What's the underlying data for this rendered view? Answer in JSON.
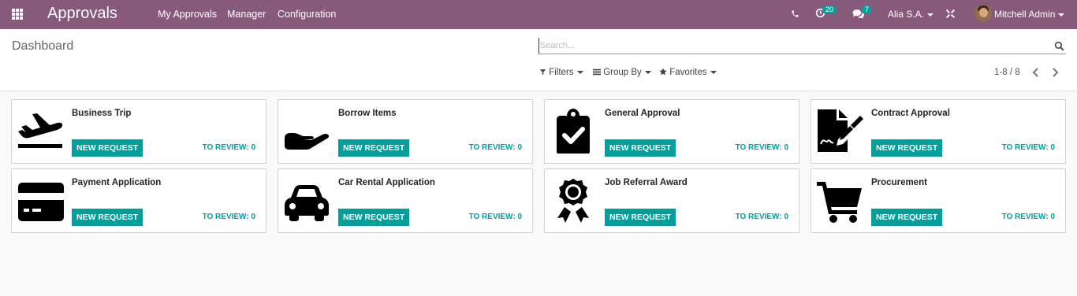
{
  "navbar": {
    "app_title": "Approvals",
    "menu": [
      "My Approvals",
      "Manager",
      "Configuration"
    ],
    "activity_count": "20",
    "messages_count": "7",
    "company": "Alia S.A.",
    "user": "Mitchell Admin",
    "color": "#875a7b"
  },
  "control_panel": {
    "breadcrumb": "Dashboard",
    "search_placeholder": "Search...",
    "filters_label": "Filters",
    "group_by_label": "Group By",
    "favorites_label": "Favorites",
    "pager": "1-8 / 8"
  },
  "cards": [
    {
      "name": "Business Trip",
      "icon": "plane-icon",
      "button": "NEW REQUEST",
      "review_label": "TO REVIEW:",
      "review_count": "0"
    },
    {
      "name": "Borrow Items",
      "icon": "hand-icon",
      "button": "NEW REQUEST",
      "review_label": "TO REVIEW:",
      "review_count": "0"
    },
    {
      "name": "General Approval",
      "icon": "clipboard-check-icon",
      "button": "NEW REQUEST",
      "review_label": "TO REVIEW:",
      "review_count": "0"
    },
    {
      "name": "Contract Approval",
      "icon": "file-signature-icon",
      "button": "NEW REQUEST",
      "review_label": "TO REVIEW:",
      "review_count": "0"
    },
    {
      "name": "Payment Application",
      "icon": "credit-card-icon",
      "button": "NEW REQUEST",
      "review_label": "TO REVIEW:",
      "review_count": "0"
    },
    {
      "name": "Car Rental Application",
      "icon": "car-icon",
      "button": "NEW REQUEST",
      "review_label": "TO REVIEW:",
      "review_count": "0"
    },
    {
      "name": "Job Referral Award",
      "icon": "award-icon",
      "button": "NEW REQUEST",
      "review_label": "TO REVIEW:",
      "review_count": "0"
    },
    {
      "name": "Procurement",
      "icon": "shopping-cart-icon",
      "button": "NEW REQUEST",
      "review_label": "TO REVIEW:",
      "review_count": "0"
    }
  ],
  "accent_color": "#00a09d"
}
